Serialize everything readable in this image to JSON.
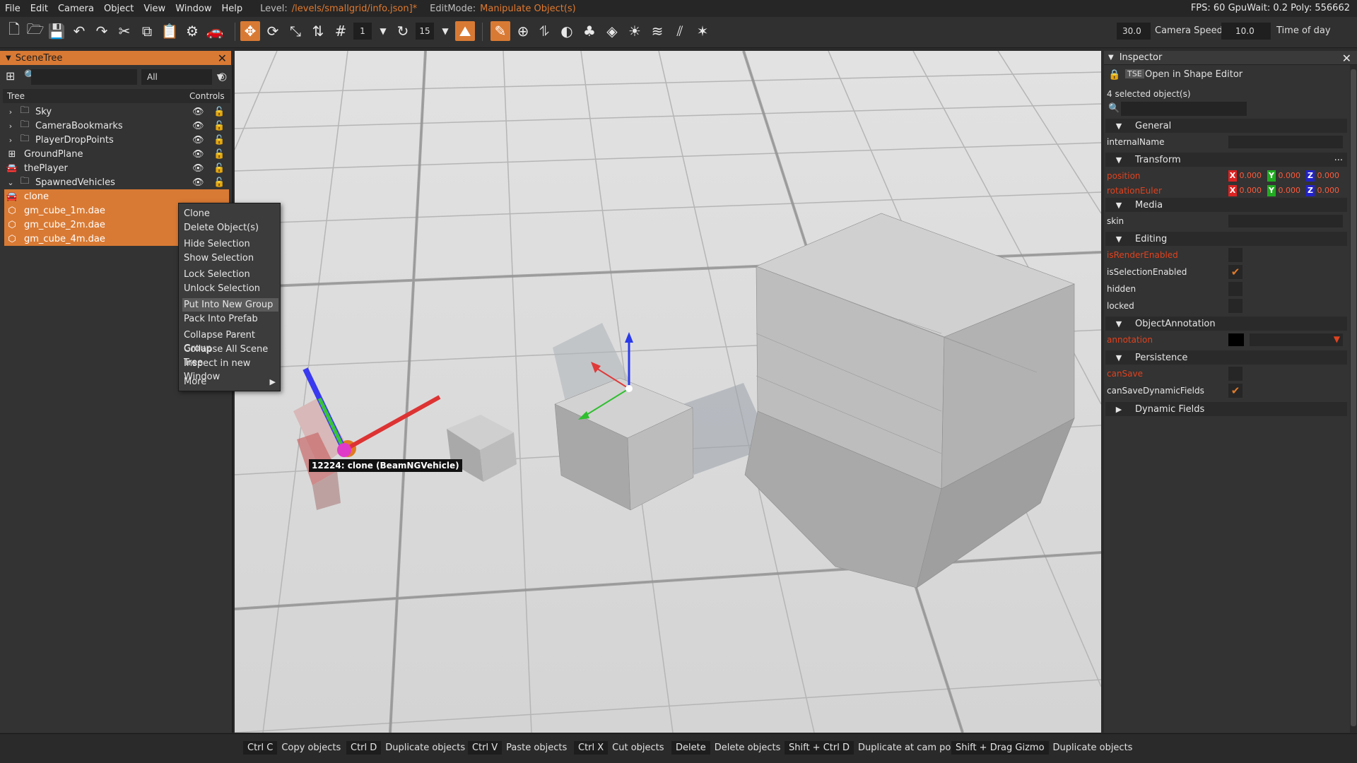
{
  "menubar": {
    "items": [
      "File",
      "Edit",
      "Camera",
      "Object",
      "View",
      "Window",
      "Help"
    ],
    "level_label": "Level:",
    "level_value": "/levels/smallgrid/info.json]*",
    "editmode_label": "EditMode:",
    "editmode_value": "Manipulate Object(s)",
    "stats": "FPS: 60  GpuWait: 0.2  Poly: 556662"
  },
  "toolbar": {
    "snap_value_1": "1",
    "snap_value_2": "15",
    "camera_speed_value": "30.0",
    "camera_speed_label": "Camera Speed",
    "time_of_day_value": "10.0",
    "time_of_day_label": "Time of day"
  },
  "scenetree": {
    "title": "SceneTree",
    "filter": "All",
    "col_tree": "Tree",
    "col_controls": "Controls",
    "rows": [
      {
        "label": "Sky",
        "icon": "folder-icon",
        "arrow": "›"
      },
      {
        "label": "CameraBookmarks",
        "icon": "folder-icon",
        "arrow": "›"
      },
      {
        "label": "PlayerDropPoints",
        "icon": "folder-icon",
        "arrow": "›"
      },
      {
        "label": "GroundPlane",
        "icon": "grid-icon",
        "arrow": ""
      },
      {
        "label": "thePlayer",
        "icon": "car-icon",
        "arrow": ""
      },
      {
        "label": "SpawnedVehicles",
        "icon": "folder-icon",
        "arrow": "⌄"
      },
      {
        "label": "clone",
        "icon": "car-icon",
        "arrow": ""
      },
      {
        "label": "gm_cube_1m.dae",
        "icon": "mesh-icon",
        "arrow": ""
      },
      {
        "label": "gm_cube_2m.dae",
        "icon": "mesh-icon",
        "arrow": ""
      },
      {
        "label": "gm_cube_4m.dae",
        "icon": "mesh-icon",
        "arrow": ""
      }
    ]
  },
  "context_menu": {
    "items": [
      "Clone",
      "Delete Object(s)",
      "Hide Selection",
      "Show Selection",
      "Lock Selection",
      "Unlock Selection",
      "Put Into New Group",
      "Pack Into Prefab",
      "Collapse Parent Group",
      "Collapse All Scene Tree",
      "Inspect in new Window",
      "More"
    ]
  },
  "viewport": {
    "vehicle_label": "12224: clone (BeamNGVehicle)"
  },
  "inspector": {
    "title": "Inspector",
    "open_shape_editor": "Open in Shape Editor",
    "selected_count": "4 selected object(s)",
    "sections": {
      "general": "General",
      "transform": "Transform",
      "media": "Media",
      "editing": "Editing",
      "annotation": "ObjectAnnotation",
      "persistence": "Persistence",
      "dynamic": "Dynamic Fields"
    },
    "props": {
      "internalName": "internalName",
      "position": "position",
      "rotationEuler": "rotationEuler",
      "skin": "skin",
      "isRenderEnabled": "isRenderEnabled",
      "isSelectionEnabled": "isSelectionEnabled",
      "hidden": "hidden",
      "locked": "locked",
      "annotation": "annotation",
      "canSave": "canSave",
      "canSaveDynamicFields": "canSaveDynamicFields"
    },
    "vec_value": "0.000",
    "ellipsis": "..."
  },
  "statusbar": {
    "hints": [
      {
        "key": "Ctrl C",
        "action": "Copy objects"
      },
      {
        "key": "Ctrl D",
        "action": "Duplicate objects"
      },
      {
        "key": "Ctrl V",
        "action": "Paste objects"
      },
      {
        "key": "Ctrl X",
        "action": "Cut objects"
      },
      {
        "key": "Delete",
        "action": "Delete objects"
      },
      {
        "key": "Shift + Ctrl D",
        "action": "Duplicate at cam pos"
      },
      {
        "key": "Shift + Drag Gizmo",
        "action": "Duplicate objects"
      }
    ]
  },
  "colors": {
    "accent": "#d97a34",
    "panel": "#333333",
    "red_property": "#e0421f"
  }
}
